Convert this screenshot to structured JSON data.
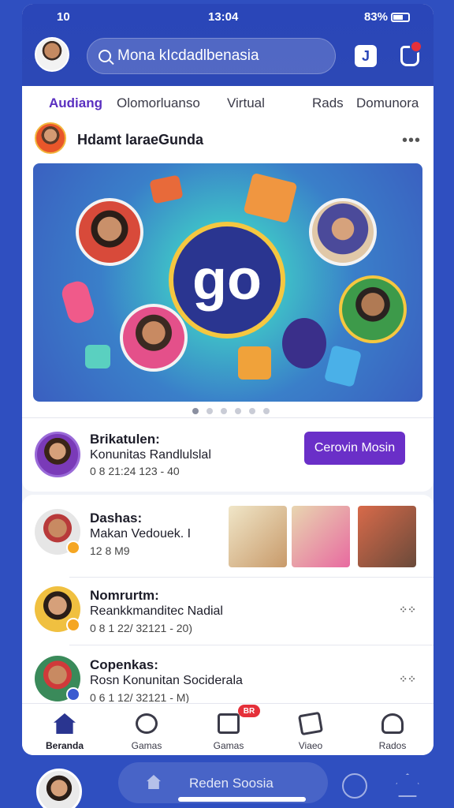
{
  "status_bar": {
    "signal": "10",
    "time": "13:04",
    "battery": "83%"
  },
  "header": {
    "search_text": "Mona kIcdadlbenasia",
    "music_icon_label": "J"
  },
  "tabs": [
    "Audiang",
    "Olomorluanso",
    "Virtual",
    "Rads",
    "Domunora"
  ],
  "post": {
    "title": "Hdamt laraeGunda",
    "menu": "•••",
    "logo_text": "go",
    "carousel_pages": 6,
    "carousel_active": 0
  },
  "featured": {
    "name": "Brikatulen:",
    "subtitle": "Konunitas Randlulslal",
    "time": "0 8 21:24 123 - 40",
    "button": "Cerovin Mosin"
  },
  "list": [
    {
      "name": "Dashas:",
      "subtitle": "Makan Vedouek. I",
      "time": "12 8  M9"
    },
    {
      "name": "Nomrurtm:",
      "subtitle": "Reankkmanditec Nadial",
      "time": "0 8 1 22/ 32121 - 20)"
    },
    {
      "name": "Copenkas:",
      "subtitle": "Rosn Konunitan Sociderala",
      "time": "0 6 1 12/ 32121 - M)"
    }
  ],
  "more_icon": "⁘⁘",
  "nav": [
    {
      "label": "Beranda",
      "icon": "home-icon"
    },
    {
      "label": "Gamas",
      "icon": "compass-icon"
    },
    {
      "label": "Gamas",
      "icon": "game-icon"
    },
    {
      "label": "Viaeo",
      "icon": "video-icon"
    },
    {
      "label": "Rados",
      "icon": "profile-icon"
    }
  ],
  "nav_badge": "BR",
  "bottom": {
    "text": "Reden Soosia"
  },
  "colors": {
    "brand": "#2a46b8",
    "accent": "#6a2fc8",
    "badge": "#e5303a"
  }
}
